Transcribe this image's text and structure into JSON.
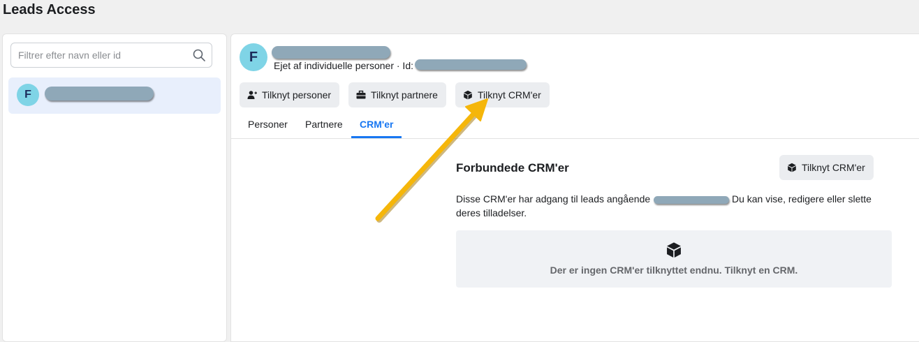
{
  "page": {
    "title": "Leads Access"
  },
  "sidebar": {
    "search": {
      "placeholder": "Filtrer efter navn eller id"
    },
    "items": [
      {
        "initial": "F"
      }
    ]
  },
  "detail": {
    "initial": "F",
    "owner_text": "Ejet af individuelle personer · Id:",
    "buttons": {
      "connect_people": "Tilknyt personer",
      "connect_partners": "Tilknyt partnere",
      "connect_crm": "Tilknyt CRM'er"
    },
    "tabs": [
      {
        "label": "Personer",
        "active": false
      },
      {
        "label": "Partnere",
        "active": false
      },
      {
        "label": "CRM'er",
        "active": true
      }
    ],
    "crm_section": {
      "title": "Forbundede CRM'er",
      "button": "Tilknyt CRM'er",
      "desc_before": "Disse CRM'er har adgang til leads angående",
      "desc_after": "Du kan vise, redigere eller slette deres tilladelser.",
      "empty_message": "Der er ingen CRM'er tilknyttet endnu. Tilknyt en CRM."
    }
  },
  "colors": {
    "accent": "#1877f2",
    "avatar_bg": "#7fd4e6",
    "annotation_arrow": "#f5b60a"
  }
}
